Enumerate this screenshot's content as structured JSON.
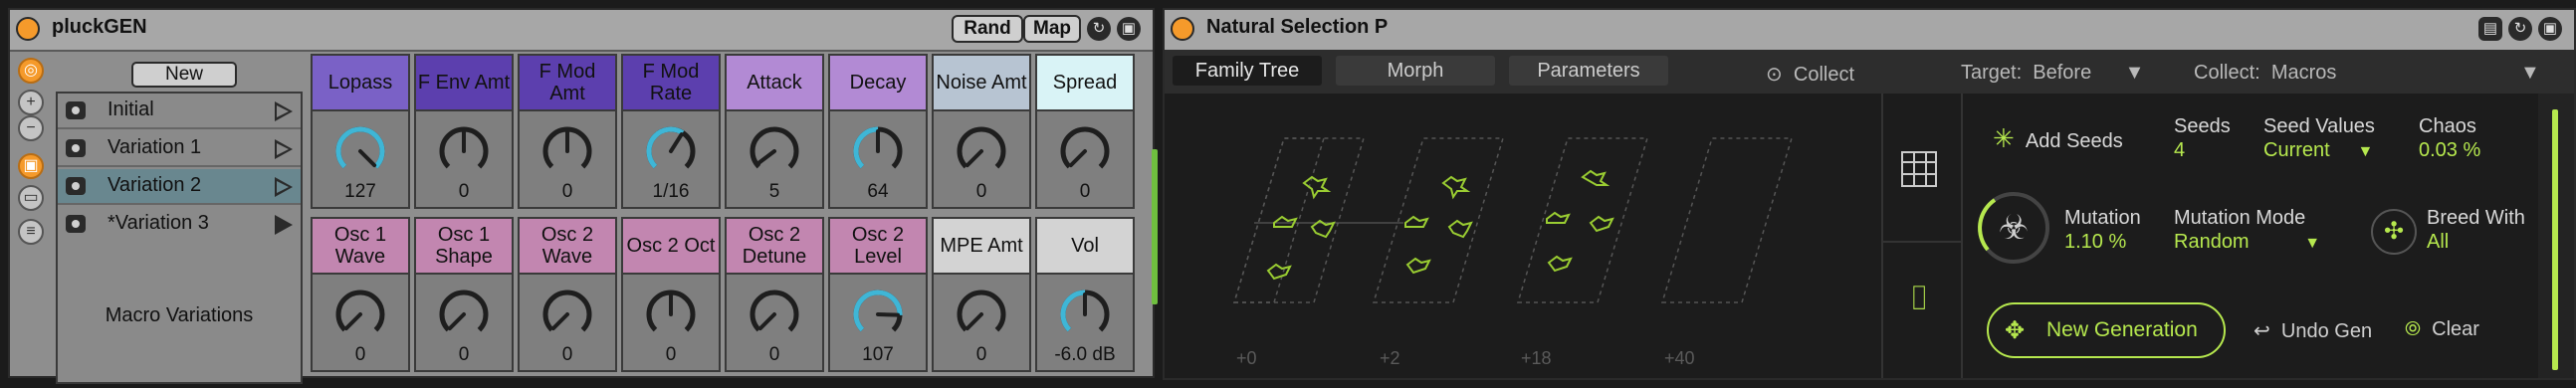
{
  "left_device": {
    "title": "pluckGEN",
    "rand_label": "Rand",
    "map_label": "Map",
    "new_label": "New",
    "variations": [
      {
        "label": "Initial",
        "selected": false,
        "filled": false
      },
      {
        "label": "Variation 1",
        "selected": false,
        "filled": false
      },
      {
        "label": "Variation 2",
        "selected": true,
        "filled": false
      },
      {
        "label": "*Variation 3",
        "selected": false,
        "filled": true
      }
    ],
    "macro_variations_label": "Macro Variations",
    "knobs_row1": [
      {
        "label": "Lopass",
        "value": "127",
        "color": "#7a61c6",
        "level": 1.0,
        "accent": true
      },
      {
        "label": "F Env Amt",
        "value": "0",
        "color": "#5c3fae",
        "level": 0.5,
        "accent": false
      },
      {
        "label": "F Mod Amt",
        "value": "0",
        "color": "#5c3fae",
        "level": 0.5,
        "accent": false
      },
      {
        "label": "F Mod Rate",
        "value": "1/16",
        "color": "#5c3fae",
        "level": 0.62,
        "accent": true
      },
      {
        "label": "Attack",
        "value": "5",
        "color": "#b28ad4",
        "level": 0.03,
        "accent": false
      },
      {
        "label": "Decay",
        "value": "64",
        "color": "#b28ad4",
        "level": 0.5,
        "accent": true
      },
      {
        "label": "Noise Amt",
        "value": "0",
        "color": "#b7c4d2",
        "level": 0.0,
        "accent": false
      },
      {
        "label": "Spread",
        "value": "0",
        "color": "#d9f3f6",
        "level": 0.0,
        "accent": false
      }
    ],
    "knobs_row2": [
      {
        "label": "Osc 1 Wave",
        "value": "0",
        "color": "#c286b0",
        "level": 0.0,
        "accent": false
      },
      {
        "label": "Osc 1 Shape",
        "value": "0",
        "color": "#c286b0",
        "level": 0.0,
        "accent": false
      },
      {
        "label": "Osc 2 Wave",
        "value": "0",
        "color": "#c286b0",
        "level": 0.0,
        "accent": false
      },
      {
        "label": "Osc 2 Oct",
        "value": "0",
        "color": "#c286b0",
        "level": 0.5,
        "accent": false
      },
      {
        "label": "Osc 2 Detune",
        "value": "0",
        "color": "#c286b0",
        "level": 0.0,
        "accent": false
      },
      {
        "label": "Osc 2 Level",
        "value": "107",
        "color": "#c286b0",
        "level": 0.84,
        "accent": true
      },
      {
        "label": "MPE Amt",
        "value": "0",
        "color": "#d3d3d3",
        "level": 0.0,
        "accent": false
      },
      {
        "label": "Vol",
        "value": "-6.0 dB",
        "color": "#d3d3d3",
        "level": 0.5,
        "accent": true
      }
    ]
  },
  "right_device": {
    "title": "Natural Selection P",
    "tabs": [
      "Family Tree",
      "Morph",
      "Parameters"
    ],
    "active_tab": "Family Tree",
    "collect_button": "Collect",
    "target_label": "Target:",
    "target_value": "Before",
    "collect_label": "Collect:",
    "collect_value": "Macros",
    "generations": [
      "+0",
      "+2",
      "+18",
      "+40"
    ],
    "add_seeds_label": "Add Seeds",
    "seeds_label": "Seeds",
    "seeds_value": "4",
    "seed_values_label": "Seed Values",
    "seed_values_value": "Current",
    "chaos_label": "Chaos",
    "chaos_value": "0.03 %",
    "mutation_label": "Mutation",
    "mutation_value": "1.10 %",
    "mutation_mode_label": "Mutation Mode",
    "mutation_mode_value": "Random",
    "breed_with_label": "Breed With",
    "breed_with_value": "All",
    "new_generation_label": "New Generation",
    "undo_gen_label": "Undo Gen",
    "clear_label": "Clear",
    "accent_color": "#b6e84e"
  }
}
